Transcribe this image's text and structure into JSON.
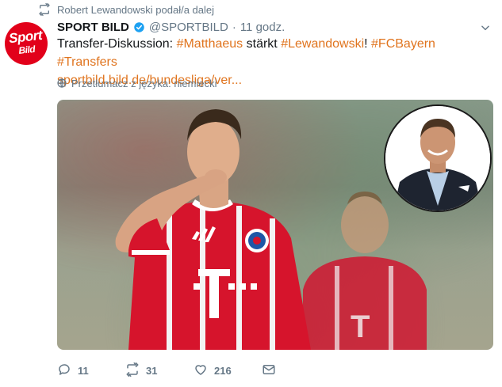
{
  "retweet_context": {
    "text": "Robert Lewandowski podał/a dalej",
    "icon": "retweet-icon"
  },
  "tweet": {
    "avatar_logo": {
      "line1": "Sport",
      "line2": "Bild"
    },
    "author_name": "SPORT BILD",
    "verified": true,
    "handle": "@SPORTBILD",
    "dot": "·",
    "time": "11 godz.",
    "text_parts": {
      "prefix": "Transfer-Diskussion: ",
      "hashtag1": "#Matthaeus",
      "middle": " stärkt ",
      "hashtag2": "#Lewandowski",
      "bang": "! ",
      "hashtag3": "#FCBayern",
      "space": " ",
      "hashtag4": "#Transfers",
      "link": "sportbild.bild.de/bundesliga/ver..."
    },
    "translate_label": "Przetłumacz z języka: niemiecki",
    "link_color": "#e0741e",
    "accent_red": "#e2001a"
  },
  "actions": {
    "reply_count": "11",
    "retweet_count": "31",
    "like_count": "216"
  }
}
